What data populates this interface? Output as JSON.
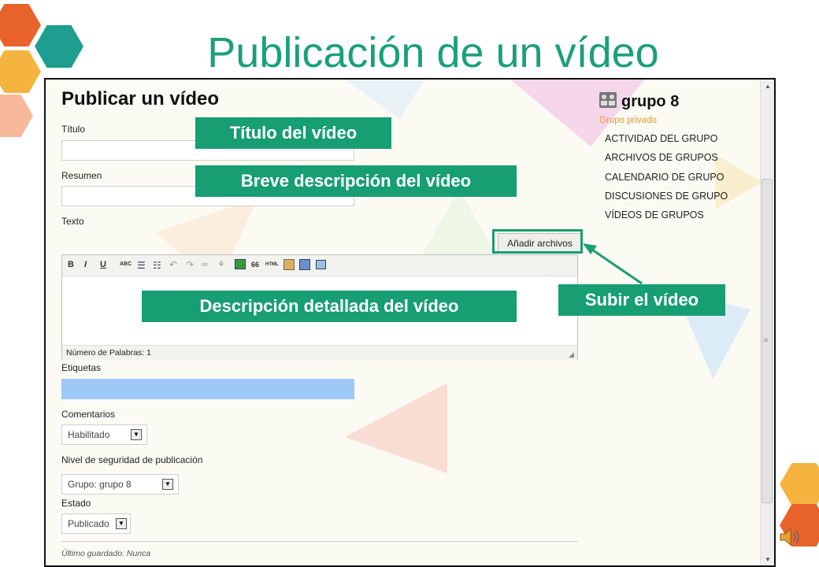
{
  "slide": {
    "title": "Publicación de un vídeo"
  },
  "form": {
    "heading": "Publicar un vídeo",
    "titulo_label": "Título",
    "resumen_label": "Resumen",
    "texto_label": "Texto",
    "add_files_button": "Añadir archivos",
    "word_count": "Número de Palabras: 1",
    "etiquetas_label": "Etiquetas",
    "comentarios_label": "Comentarios",
    "comentarios_value": "Habilitado",
    "seguridad_label": "Nivel de seguridad de publicación",
    "seguridad_value": "Grupo: grupo 8",
    "estado_label": "Estado",
    "estado_value": "Publicado",
    "last_saved": "Último guardado: Nunca",
    "toolbar": {
      "bold": "B",
      "italic": "I",
      "underline": "U",
      "spell": "ABC",
      "quote": "66",
      "html": "HTML"
    }
  },
  "group": {
    "name": "grupo 8",
    "privacy": "Grupo privado",
    "menu": [
      "ACTIVIDAD DEL GRUPO",
      "ARCHIVOS DE GRUPOS",
      "CALENDARIO DE GRUPO",
      "DISCUSIONES DE GRUPO",
      "VÍDEOS DE GRUPOS"
    ]
  },
  "callouts": {
    "titulo": "Título del vídeo",
    "resumen": "Breve descripción del  vídeo",
    "texto": "Descripción detallada del vídeo",
    "subir": "Subir el vídeo"
  },
  "colors": {
    "accent_green": "#179e73",
    "title_green": "#1aa07a",
    "orange": "#e8632b",
    "gold": "#f5b33f",
    "teal": "#1d9e8e",
    "tag_field_blue": "#9dc8f8"
  },
  "icons": {
    "group": "group-icon",
    "speaker": "speaker-icon",
    "resize": "resize-grip-icon"
  }
}
